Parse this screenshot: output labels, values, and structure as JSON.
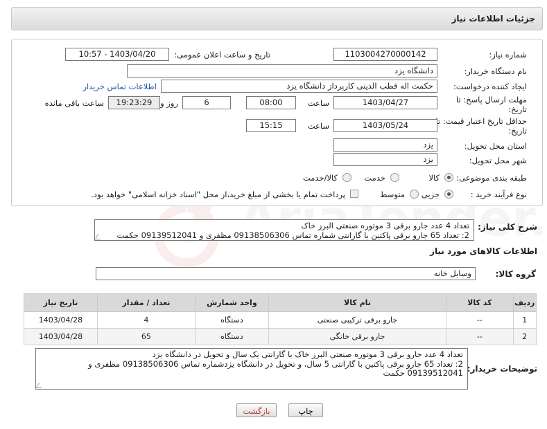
{
  "header": {
    "title": "جزئیات اطلاعات نیاز"
  },
  "form": {
    "need_number_label": "شماره نیاز:",
    "need_number": "1103004270000142",
    "announce_label": "تاریخ و ساعت اعلان عمومی:",
    "announce_value": "1403/04/20 - 10:57",
    "buyer_org_label": "نام دستگاه خریدار:",
    "buyer_org": "دانشگاه یزد",
    "requester_label": "ایجاد کننده درخواست:",
    "requester": "حکمت اله قطب الدینی کارپرداز دانشگاه یزد",
    "contact_link": "اطلاعات تماس خریدار",
    "deadline_label_1": "مهلت ارسال پاسخ: تا",
    "deadline_label_2": "تاریخ:",
    "deadline_date": "1403/04/27",
    "time_label": "ساعت",
    "deadline_time": "08:00",
    "days_value": "6",
    "days_label": "روز و",
    "remaining_time": "19:23:29",
    "remaining_label": "ساعت باقی مانده",
    "validity_label_1": "حداقل تاریخ اعتبار قیمت: تا",
    "validity_label_2": "تاریخ:",
    "validity_date": "1403/05/24",
    "validity_time": "15:15",
    "province_label": "استان محل تحویل:",
    "province": "یزد",
    "city_label": "شهر محل تحویل:",
    "city": "یزد",
    "category_label": "طبقه بندی موضوعی:",
    "category_options": [
      "کالا",
      "خدمت",
      "کالا/خدمت"
    ],
    "process_label": "نوع فرآیند خرید :",
    "process_options": [
      "جزیی",
      "متوسط"
    ],
    "payment_note": "پرداخت تمام یا بخشی از مبلغ خرید،از محل \"اسناد خزانه اسلامی\" خواهد بود."
  },
  "summary": {
    "label": "شرح کلی نیاز:",
    "lines": [
      "تعداد 4 عدد جارو برقی  3 موتوره صنعتی البرز خاک",
      "2: تعداد  65 جارو برقی پاکتین  با گارانتی شماره تماس 09138506306 مظفری و 09139512041 حکمت"
    ]
  },
  "goods": {
    "section_title": "اطلاعات کالاهای مورد نیاز",
    "group_label": "گروه کالا:",
    "group_value": "وسایل خانه",
    "columns": [
      "ردیف",
      "کد کالا",
      "نام کالا",
      "واحد شمارش",
      "تعداد / مقدار",
      "تاریخ نیاز"
    ],
    "rows": [
      {
        "row": "1",
        "code": "--",
        "name": "جارو برقی ترکیبی صنعتی",
        "unit": "دستگاه",
        "qty": "4",
        "date": "1403/04/28"
      },
      {
        "row": "2",
        "code": "--",
        "name": "جارو برقی خانگی",
        "unit": "دستگاه",
        "qty": "65",
        "date": "1403/04/28"
      }
    ]
  },
  "buyer_notes": {
    "label": "توضیحات خریدار:",
    "lines": [
      "تعداد 4 عدد جارو برقی  3 موتوره صنعتی البرز خاک با گارانتی یک سال و تحویل در دانشگاه یزد",
      "2: تعداد  65 جارو برقی پاکتین  با گارانتی  5 سال، و تحویل در دانشگاه یزدشماره تماس 09138506306 مظفری و",
      "09139512041 حکمت"
    ]
  },
  "buttons": {
    "print": "چاپ",
    "back": "بازگشت"
  },
  "colors": {
    "link": "#1f5aa8",
    "back_text": "#c0392b",
    "header_bg": "#e6e6e6",
    "table_header_bg": "#d9d9d9"
  }
}
